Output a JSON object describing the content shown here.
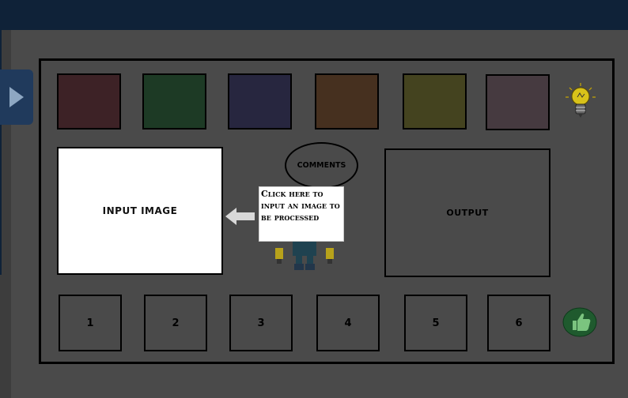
{
  "colors": {
    "topbar": "#0f2238",
    "background": "#4a4a4a",
    "swatches": [
      "#3d2226",
      "#1d3a25",
      "#27263f",
      "#46301f",
      "#44431f",
      "#463a40"
    ]
  },
  "side_tab": {
    "icon": "play-triangle-icon"
  },
  "hint": {
    "icon": "light-bulb-icon"
  },
  "input_image": {
    "label": "INPUT IMAGE"
  },
  "comments": {
    "label": "COMMENTS"
  },
  "tooltip": {
    "text": "Click here to input an image to be processed"
  },
  "output": {
    "label": "OUTPUT"
  },
  "slots": [
    "1",
    "2",
    "3",
    "4",
    "5",
    "6"
  ],
  "confirm": {
    "icon": "thumbs-up-icon"
  }
}
